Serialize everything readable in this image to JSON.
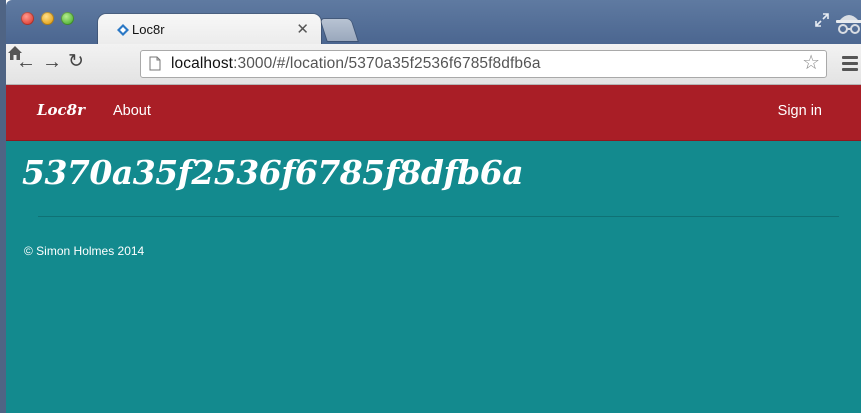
{
  "browser": {
    "tab": {
      "title": "Loc8r"
    },
    "url": {
      "host": "localhost",
      "rest": ":3000/#/location/5370a35f2536f6785f8dfb6a"
    },
    "icons": {
      "back": "back-arrow-icon",
      "forward": "forward-arrow-icon",
      "reload": "reload-icon",
      "home": "home-icon",
      "page": "page-icon",
      "bookmark": "star-icon",
      "menu": "menu-icon",
      "incognito": "incognito-icon",
      "fullscreen": "fullscreen-icon",
      "close": "close-icon"
    }
  },
  "navbar": {
    "brand": "Loc8r",
    "about": "About",
    "sign_in": "Sign in"
  },
  "main": {
    "title": "5370a35f2536f6785f8dfb6a"
  },
  "footer": {
    "text": "© Simon Holmes 2014"
  },
  "colors": {
    "navbar": "#a91e26",
    "background": "#138a8e",
    "text": "#ffffff"
  }
}
